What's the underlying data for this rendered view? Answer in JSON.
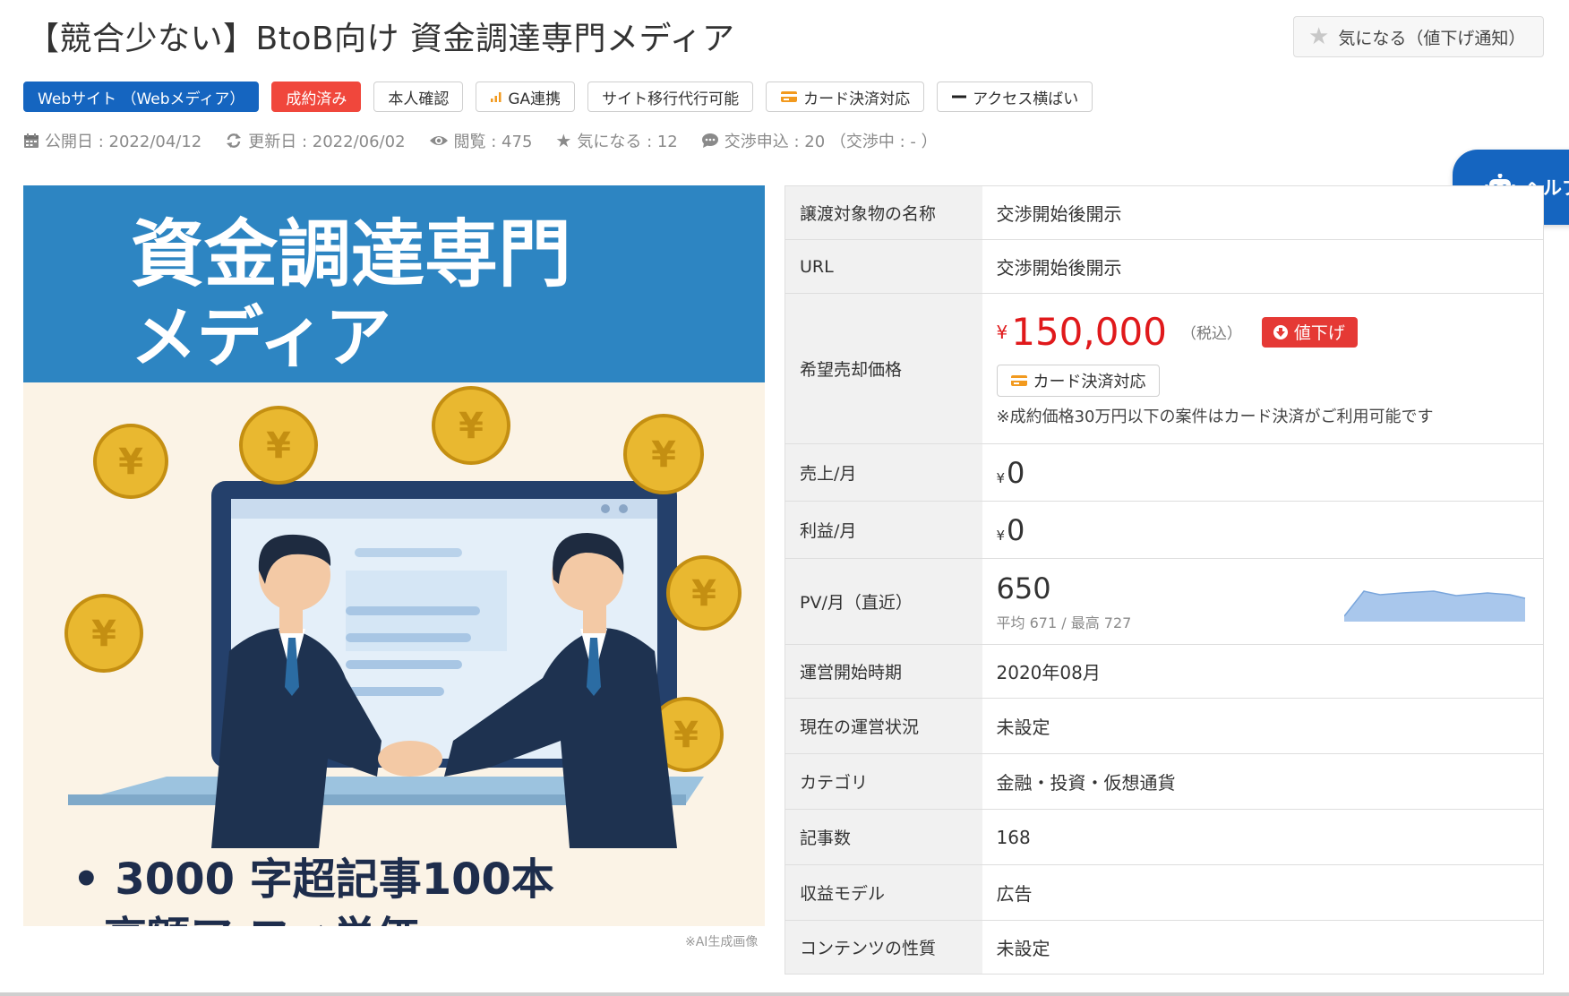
{
  "title": "【競合少ない】BtoB向け 資金調達専門メディア",
  "favorite_button": {
    "label": "気になる（値下げ通知）",
    "icon": "star-icon"
  },
  "tags": [
    {
      "label": "Webサイト （Webメディア）",
      "style": "primary"
    },
    {
      "label": "成約済み",
      "style": "red"
    },
    {
      "label": "本人確認",
      "style": "plain"
    },
    {
      "label": "GA連携",
      "style": "plain",
      "icon": "bar-chart-icon"
    },
    {
      "label": "サイト移行代行可能",
      "style": "plain"
    },
    {
      "label": "カード決済対応",
      "style": "plain",
      "icon": "credit-card-icon"
    },
    {
      "label": "アクセス横ばい",
      "style": "plain",
      "icon": "dash-icon"
    }
  ],
  "meta": {
    "published": "公開日 : 2022/04/12",
    "updated": "更新日 : 2022/06/02",
    "views": "閲覧 : 475",
    "favorites": "気になる : 12",
    "offers": "交渉申込 : 20 （交渉中 : - ）"
  },
  "helper": {
    "label": "ヘルプ"
  },
  "thumbnail": {
    "title_line1": "資金調達専門",
    "title_line2": "メディア",
    "bullet1": "• 3000 字超記事100本",
    "bullet2": "高額ア フィ単価",
    "ai_note": "※AI生成画像"
  },
  "spec": {
    "name": {
      "label": "譲渡対象物の名称",
      "value": "交渉開始後開示"
    },
    "url": {
      "label": "URL",
      "value": "交渉開始後開示"
    },
    "price": {
      "label": "希望売却価格",
      "currency": "¥",
      "amount": "150,000",
      "tax": "（税込）",
      "discount_badge": "値下げ",
      "card_badge": "カード決済対応",
      "note": "※成約価格30万円以下の案件はカード決済がご利用可能です"
    },
    "sales": {
      "label": "売上/月",
      "currency": "¥",
      "value": "0"
    },
    "profit": {
      "label": "利益/月",
      "currency": "¥",
      "value": "0"
    },
    "pv": {
      "label": "PV/月（直近）",
      "value": "650",
      "sub": "平均 671 / 最高 727"
    },
    "start": {
      "label": "運営開始時期",
      "value": "2020年08月"
    },
    "status": {
      "label": "現在の運営状況",
      "value": "未設定"
    },
    "category": {
      "label": "カテゴリ",
      "value": "金融・投資・仮想通貨"
    },
    "articles": {
      "label": "記事数",
      "value": "168"
    },
    "revenue_model": {
      "label": "収益モデル",
      "value": "広告"
    },
    "content_type": {
      "label": "コンテンツの性質",
      "value": "未設定"
    }
  },
  "colors": {
    "primary": "#1565c0",
    "accent_red": "#e0191b",
    "tag_red": "#f0473c",
    "sparkline": "#a9c7ec"
  }
}
